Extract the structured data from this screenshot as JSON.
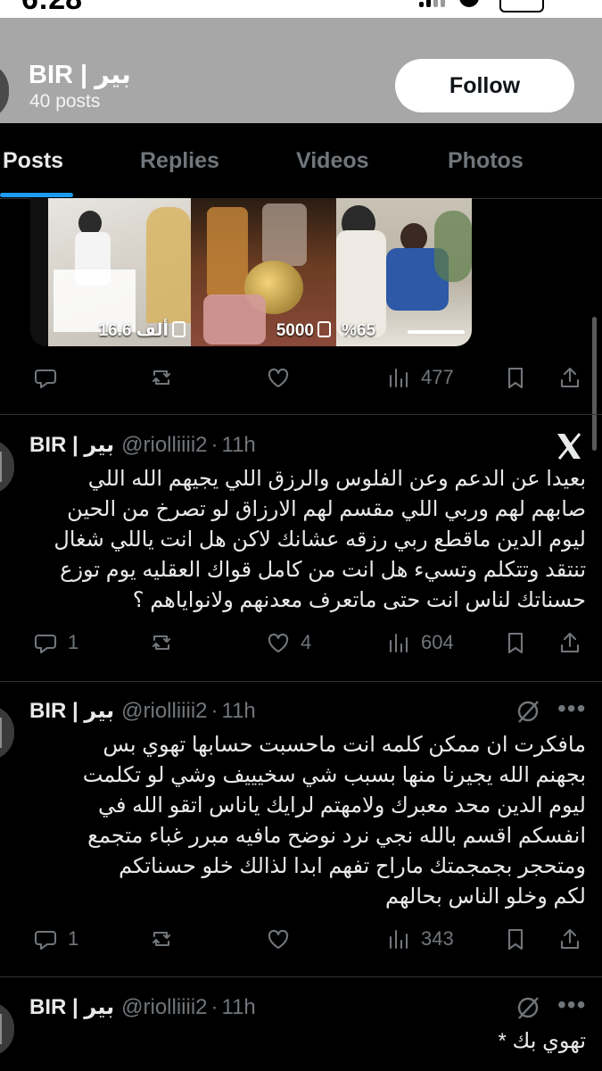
{
  "status": {
    "time": "6:28"
  },
  "profile": {
    "name": "BIR | بير",
    "posts_count": "40 posts",
    "follow_label": "Follow"
  },
  "tabs": [
    {
      "label": "Posts",
      "active": true
    },
    {
      "label": "Replies"
    },
    {
      "label": "Videos"
    },
    {
      "label": "Photos"
    }
  ],
  "media": {
    "thumbs": [
      {
        "label": "16.6 ألف"
      },
      {
        "label": "5000"
      },
      {
        "label": "%65"
      }
    ]
  },
  "posts": [
    {
      "actions": {
        "reply": "",
        "repost": "",
        "like": "",
        "views": "477"
      }
    },
    {
      "author": "BIR | بير",
      "handle": "@riolliiii2",
      "time": "11h",
      "lines": [
        "بعيدا عن الدعم وعن الفلوس والرزق اللي يجيهم الله اللي",
        "صابهم لهم وربي اللي مقسم لهم الارزاق لو تصرخ من الحين",
        "ليوم الدين ماقطع ربي رزقه عشانك لاكن هل انت ياللي شغال",
        "تنتقد وتتكلم وتسيء هل انت من كامل قواك العقليه يوم توزع",
        "حسناتك لناس انت حتى ماتعرف معدنهم ولانواياهم ؟"
      ],
      "actions": {
        "reply": "1",
        "repost": "",
        "like": "4",
        "views": "604"
      }
    },
    {
      "author": "BIR | بير",
      "handle": "@riolliiii2",
      "time": "11h",
      "lines": [
        "مافكرت ان ممكن كلمه انت ماحسبت حسابها تهوي بس",
        "بجهنم الله يجيرنا منها بسبب شي سخيييف وشي لو تكلمت",
        "ليوم الدين محد معبرك ولامهتم لرايك ياناس اتقو الله في",
        "انفسكم اقسم بالله نجي نرد نوضح مافيه مبرر غباء متجمع",
        "ومتحجر بجمجمتك ماراح تفهم ابدا  لذالك خلو حسناتكم",
        "لكم وخلو الناس بحالهم"
      ],
      "actions": {
        "reply": "1",
        "repost": "",
        "like": "",
        "views": "343"
      }
    },
    {
      "author": "BIR | بير",
      "handle": "@riolliiii2",
      "time": "11h",
      "lines": [
        "تهوي بك *"
      ]
    }
  ],
  "icons": {
    "reply": "speech-bubble-icon",
    "repost": "repost-arrows-icon",
    "like": "heart-icon",
    "views": "bar-chart-icon",
    "bookmark": "bookmark-icon",
    "share": "share-icon",
    "x_logo": "x-logo-icon",
    "grok": "grok-icon",
    "more": "more-dots-icon"
  },
  "colors": {
    "accent": "#1d9bf0",
    "background": "#000000",
    "text": "#e7e9ea",
    "muted": "#71767b",
    "header_bg": "#a7a7a7"
  }
}
